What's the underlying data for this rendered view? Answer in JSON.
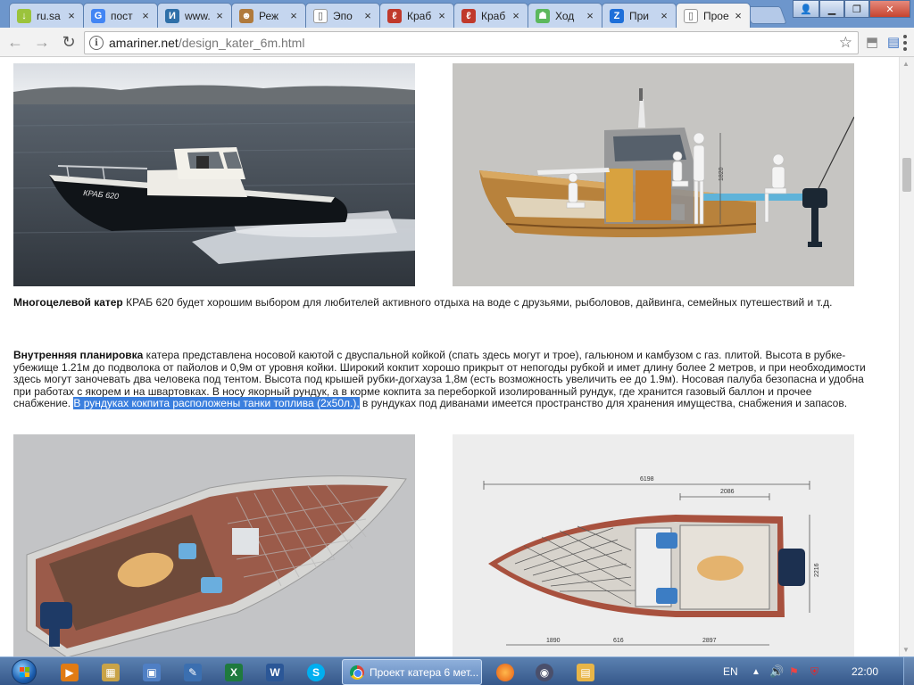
{
  "browser": {
    "tabs": [
      {
        "title": "ru.sa",
        "icon": "android-icon",
        "color": "#9bc33c",
        "glyph": "↓"
      },
      {
        "title": "пост",
        "icon": "google-icon",
        "color": "#4285f4",
        "glyph": "G"
      },
      {
        "title": "www.",
        "icon": "site-icon",
        "color": "#2e6fa8",
        "glyph": "И"
      },
      {
        "title": "Реж",
        "icon": "face-icon",
        "color": "#b07a3c",
        "glyph": "☻"
      },
      {
        "title": "Эпо",
        "icon": "page-icon",
        "color": "#ffffff",
        "glyph": "▯"
      },
      {
        "title": "Краб",
        "icon": "crab-site-icon",
        "color": "#c0392b",
        "glyph": "ℓ"
      },
      {
        "title": "Краб",
        "icon": "crab-site-icon",
        "color": "#c0392b",
        "glyph": "ℓ"
      },
      {
        "title": "Ход",
        "icon": "android-icon",
        "color": "#5cb85c",
        "glyph": "☗"
      },
      {
        "title": "При",
        "icon": "z-icon",
        "color": "#1e6fd9",
        "glyph": "Z"
      },
      {
        "title": "Прое",
        "icon": "page-icon",
        "color": "#ffffff",
        "glyph": "▯"
      }
    ],
    "active_tab": 9,
    "url_host": "amariner.net",
    "url_path": "/design_kater_6m.html"
  },
  "page": {
    "para1_bold": "Многоцелевой катер",
    "para1_text": " КРАБ 620 будет хорошим выбором для любителей активного отдыха на воде с друзьями, рыболовов, дайвинга, семейных путешествий и т.д.",
    "para2_bold": "Внутренняя планировка",
    "para2_text": " катера представлена носовой каютой с двуспальной койкой (спать здесь могут и трое), гальюном и камбузом с газ. плитой. Высота в рубке-убежище 1.21м до подволока от пайолов и 0,9м от уровня койки. Широкий кокпит хорошо прикрыт от непогоды рубкой и имет длину более 2 метров, и при необходимости здесь могут заночевать два человека под тентом. Высота под крышей рубки-догхауза 1,8м (есть возможность увеличить ее до 1.9м). Носовая палуба безопасна и удобна при работах с якорем и на швартовках. В носу якорный рундук, а в корме кокпита за переборкой изолированный рундук, где хранится газовый баллон и прочее снабжение. ",
    "para2_highlight": "В рундуках кокпита расположены танки топлива (2х50л.),",
    "para2_tail": " в рундуках под диванами имеется пространство для хранения имущества, снабжения и запасов.",
    "boat_name": "КРАБ 620",
    "dim_height": "1820",
    "dim_total": "6198",
    "dim_cockpit": "2086",
    "dim_bow": "1890",
    "dim_mid": "616",
    "dim_aft": "2897",
    "dim_beam": "2216"
  },
  "taskbar": {
    "active_window_title": "Проект катера 6 мет...",
    "language": "EN",
    "time": "22:00"
  }
}
